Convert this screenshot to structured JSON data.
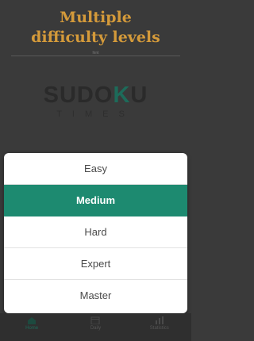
{
  "headline": {
    "line1": "Multiple",
    "line2": "difficulty levels"
  },
  "promo_small_label": "hint",
  "logo": {
    "word_part1": "SUDO",
    "word_mark": "K",
    "word_part2": "U",
    "sub": "TIMES"
  },
  "difficulty_options": [
    {
      "label": "Easy",
      "selected": false
    },
    {
      "label": "Medium",
      "selected": true
    },
    {
      "label": "Hard",
      "selected": false
    },
    {
      "label": "Expert",
      "selected": false
    },
    {
      "label": "Master",
      "selected": false
    }
  ],
  "nav": [
    {
      "label": "Home",
      "icon": "home-icon",
      "active": true
    },
    {
      "label": "Daily",
      "icon": "calendar-icon",
      "active": false
    },
    {
      "label": "Statistics",
      "icon": "bar-chart-icon",
      "active": false
    }
  ],
  "colors": {
    "background": "#3a3a3a",
    "headline": "#d49a3a",
    "accent": "#1d8a70"
  }
}
